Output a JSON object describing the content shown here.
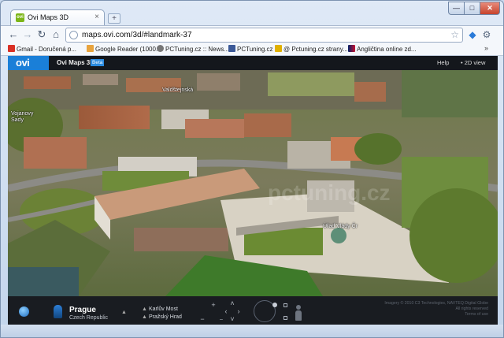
{
  "browser": {
    "tab_title": "Ovi Maps 3D",
    "tab_favicon": "ovi",
    "url": "maps.ovi.com/3d/#landmark-37",
    "bookmarks": [
      {
        "label": "Gmail - Doručená p...",
        "icon": "gmail-icon",
        "color": "#d93025"
      },
      {
        "label": "Google Reader (1000...",
        "icon": "reader-icon",
        "color": "#e8a33d"
      },
      {
        "label": "PCTuning.cz :: News...",
        "icon": "pctuning-icon",
        "color": "#777777"
      },
      {
        "label": "PCTuning.cz",
        "icon": "facebook-icon",
        "color": "#3b5998"
      },
      {
        "label": "@ Pctuning.cz strany...",
        "icon": "star-icon",
        "color": "#e0b000"
      },
      {
        "label": "Angličtina online zd...",
        "icon": "flag-uk-icon",
        "color": "#c8102e"
      }
    ],
    "bookmarks_more": "»"
  },
  "app": {
    "logo": "ovi",
    "title": "Ovi Maps 3D",
    "badge": "Beta",
    "help": "Help",
    "view_toggle": "• 2D view"
  },
  "map": {
    "labels": [
      {
        "text": "Valdštejnská",
        "name": "map-label-valdstejnska"
      },
      {
        "text": "Vojanovy Sady",
        "name": "map-label-vojanovy-sady"
      },
      {
        "text": "Úřad Vlády Čr",
        "name": "map-label-urad-vlady"
      }
    ]
  },
  "panel": {
    "city": "Prague",
    "country": "Czech Republic",
    "landmarks": [
      "Karlův Most",
      "Pražský Hrad"
    ],
    "zoom_in": "+",
    "zoom_out": "−",
    "copyright_lines": [
      "Imagery © 2010 C3 Technologies, NAVTEQ Digital Globe",
      "All rights reserved",
      "Terms of use"
    ]
  },
  "colors": {
    "accent": "#1a7fd8",
    "header_bg": "#14171c",
    "panel_bg": "#191c21"
  }
}
